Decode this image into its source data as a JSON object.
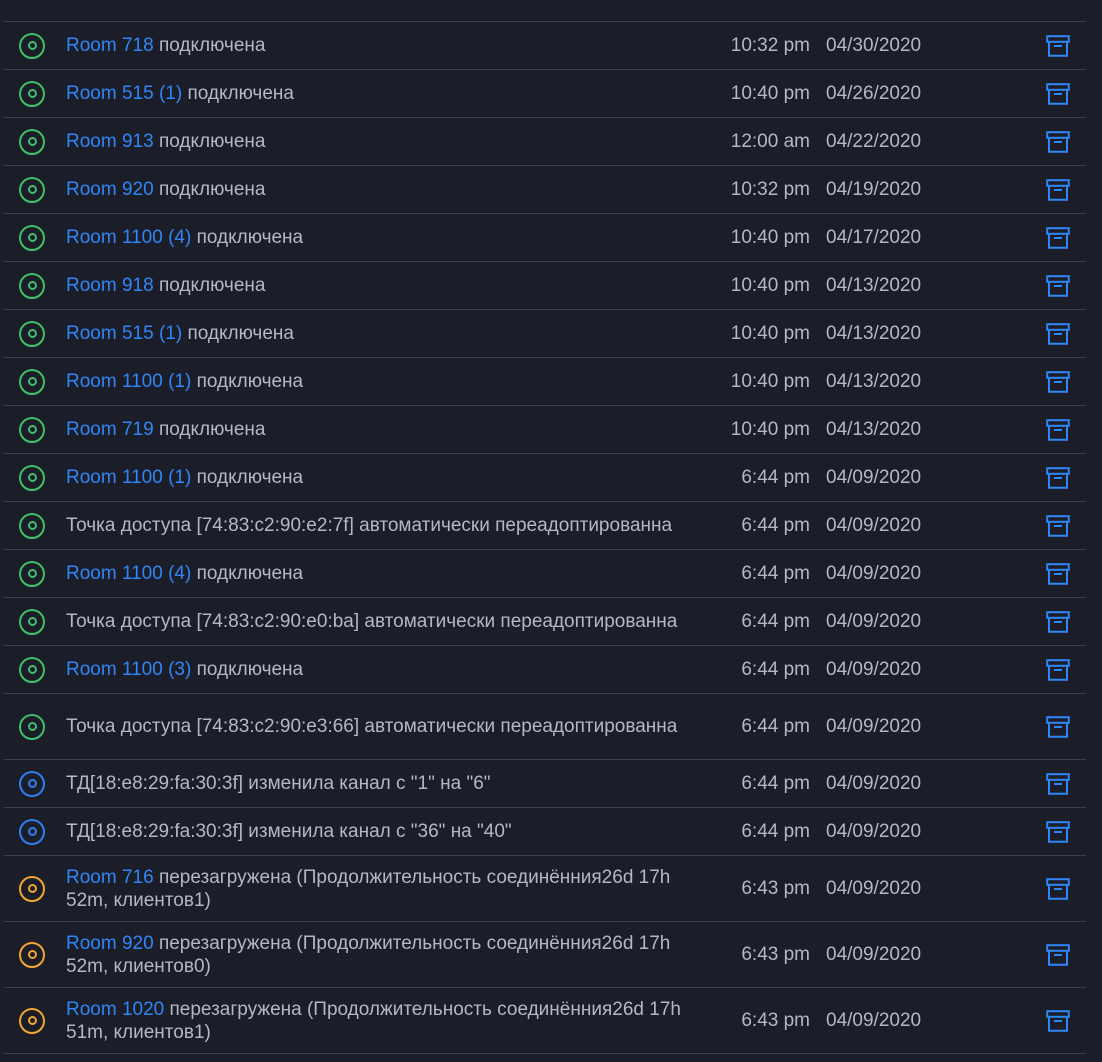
{
  "events": [
    {
      "status": "green",
      "device": "Room 718",
      "text": " подключена",
      "time": "10:32 pm",
      "date": "04/30/2020"
    },
    {
      "status": "green",
      "device": "Room 515 (1)",
      "text": " подключена",
      "time": "10:40 pm",
      "date": "04/26/2020"
    },
    {
      "status": "green",
      "device": "Room 913",
      "text": " подключена",
      "time": "12:00 am",
      "date": "04/22/2020"
    },
    {
      "status": "green",
      "device": "Room 920",
      "text": " подключена",
      "time": "10:32 pm",
      "date": "04/19/2020"
    },
    {
      "status": "green",
      "device": "Room 1100 (4)",
      "text": " подключена",
      "time": "10:40 pm",
      "date": "04/17/2020"
    },
    {
      "status": "green",
      "device": "Room 918",
      "text": " подключена",
      "time": "10:40 pm",
      "date": "04/13/2020"
    },
    {
      "status": "green",
      "device": "Room 515 (1)",
      "text": " подключена",
      "time": "10:40 pm",
      "date": "04/13/2020"
    },
    {
      "status": "green",
      "device": "Room 1100 (1)",
      "text": " подключена",
      "time": "10:40 pm",
      "date": "04/13/2020"
    },
    {
      "status": "green",
      "device": "Room 719",
      "text": " подключена",
      "time": "10:40 pm",
      "date": "04/13/2020"
    },
    {
      "status": "green",
      "device": "Room 1100 (1)",
      "text": " подключена",
      "time": "6:44 pm",
      "date": "04/09/2020"
    },
    {
      "status": "green",
      "device": "",
      "text": "Точка доступа [74:83:c2:90:e2:7f] автоматически переадоптированна",
      "time": "6:44 pm",
      "date": "04/09/2020"
    },
    {
      "status": "green",
      "device": "Room 1100 (4)",
      "text": " подключена",
      "time": "6:44 pm",
      "date": "04/09/2020"
    },
    {
      "status": "green",
      "device": "",
      "text": "Точка доступа [74:83:c2:90:e0:ba] автоматически переадоптированна",
      "time": "6:44 pm",
      "date": "04/09/2020"
    },
    {
      "status": "green",
      "device": "Room 1100 (3)",
      "text": " подключена",
      "time": "6:44 pm",
      "date": "04/09/2020"
    },
    {
      "status": "green",
      "device": "",
      "text": "Точка доступа [74:83:c2:90:e3:66] автоматически переадоптированна",
      "time": "6:44 pm",
      "date": "04/09/2020",
      "tall": true
    },
    {
      "status": "blue",
      "device": "",
      "text": "ТД[18:e8:29:fa:30:3f] изменила канал с \"1\" на \"6\"",
      "time": "6:44 pm",
      "date": "04/09/2020"
    },
    {
      "status": "blue",
      "device": "",
      "text": "ТД[18:e8:29:fa:30:3f] изменила канал с \"36\" на \"40\"",
      "time": "6:44 pm",
      "date": "04/09/2020"
    },
    {
      "status": "orange",
      "device": "Room 716",
      "text": " перезагружена (Продолжительность соединённия26d 17h 52m, клиентов1)",
      "time": "6:43 pm",
      "date": "04/09/2020",
      "tall": true
    },
    {
      "status": "orange",
      "device": "Room 920",
      "text": " перезагружена (Продолжительность соединённия26d 17h 52m, клиентов0)",
      "time": "6:43 pm",
      "date": "04/09/2020",
      "tall": true
    },
    {
      "status": "orange",
      "device": "Room 1020",
      "text": " перезагружена (Продолжительность соединённия26d 17h 51m, клиентов1)",
      "time": "6:43 pm",
      "date": "04/09/2020",
      "tall": true
    }
  ],
  "icons": {
    "status": "status-circle-icon",
    "archive": "archive-icon"
  },
  "colors": {
    "background": "#1b1e29",
    "link": "#2f86f6",
    "connected": "#3fbf6a",
    "info": "#2d7ff0",
    "warning": "#f0a630"
  }
}
